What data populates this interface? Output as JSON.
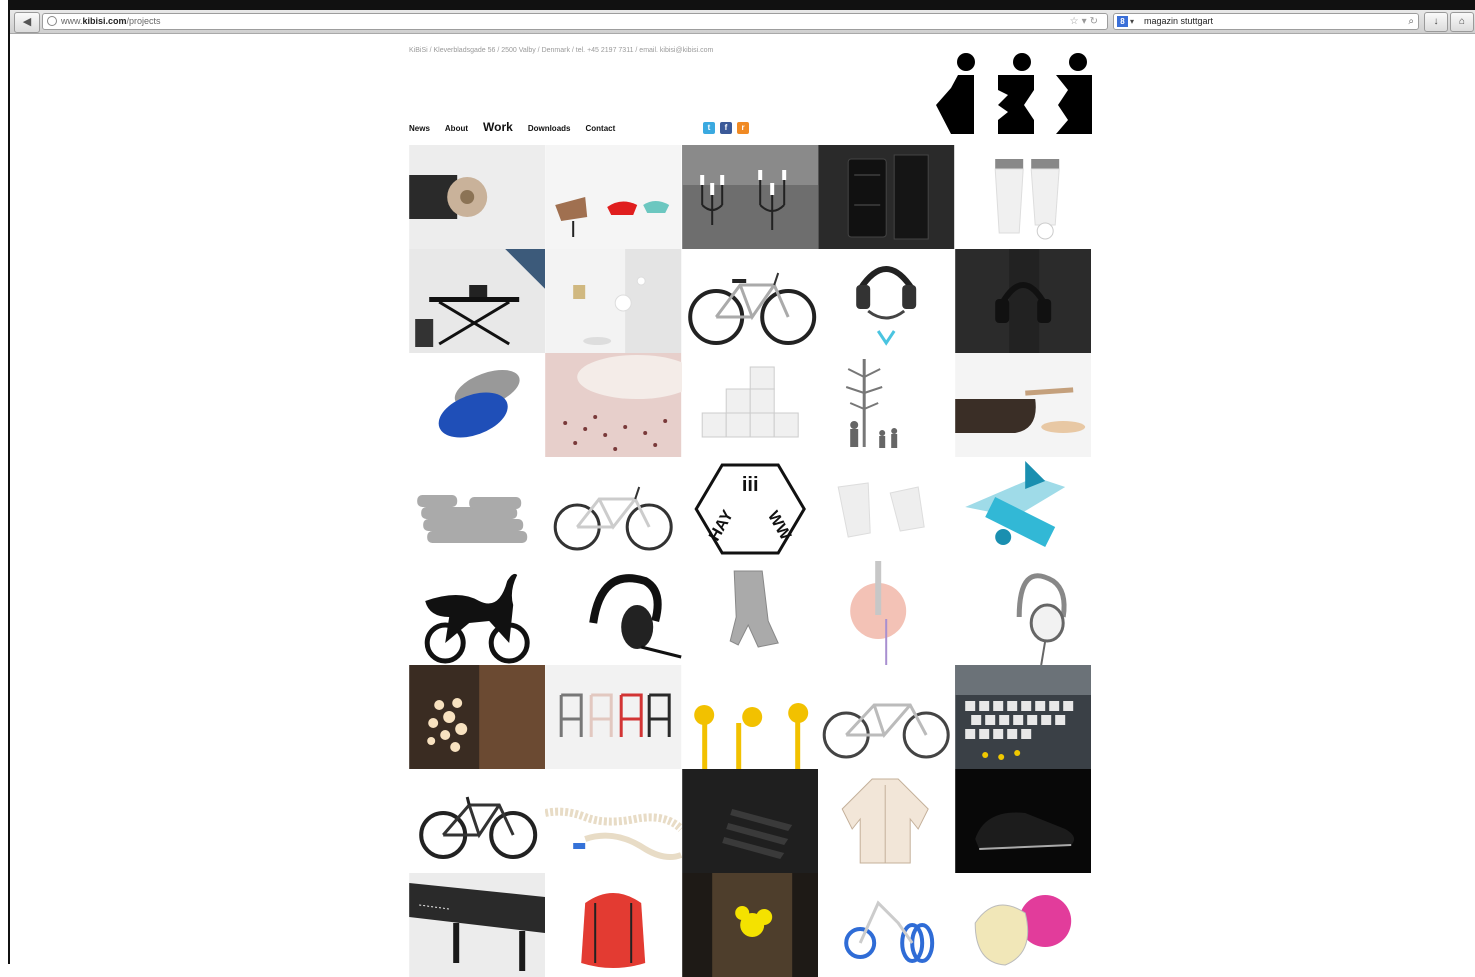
{
  "browser": {
    "url_prefix": "www.",
    "url_domain": "kibisi.com",
    "url_path": "/projects",
    "search_engine_glyph": "8",
    "search_query": "magazin stuttgart",
    "back_icon": "back-arrow-icon",
    "bookmark_icon": "star-icon",
    "reload_icon": "reload-icon",
    "download_icon": "download-icon",
    "home_icon": "home-icon"
  },
  "site": {
    "address_line": "KiBiSi / Kleverbladsgade 56 / 2500 Valby / Denmark / tel. +45 2197 7311 / email. kibisi@kibisi.com",
    "nav": [
      "News",
      "About",
      "Work",
      "Downloads",
      "Contact"
    ],
    "active_nav": "Work",
    "social": [
      {
        "name": "twitter-icon",
        "glyph": "t",
        "color": "#3aa9e0"
      },
      {
        "name": "facebook-icon",
        "glyph": "f",
        "color": "#3b5998"
      },
      {
        "name": "rss-icon",
        "glyph": "r",
        "color": "#f08a24"
      }
    ],
    "hay_www_badge": {
      "top": "iii",
      "left": "HAY",
      "right": "WW"
    }
  },
  "projects": [
    {
      "name": "wooden-fan-lamp"
    },
    {
      "name": "lounge-chairs"
    },
    {
      "name": "candle-holders"
    },
    {
      "name": "dark-electronics"
    },
    {
      "name": "white-salt-pepper"
    },
    {
      "name": "work-desk"
    },
    {
      "name": "white-interior"
    },
    {
      "name": "bicycle-grey"
    },
    {
      "name": "headphones-stand"
    },
    {
      "name": "dark-headphones"
    },
    {
      "name": "blue-grey-pouf"
    },
    {
      "name": "pink-dots-surface"
    },
    {
      "name": "shelf-system"
    },
    {
      "name": "tree-hanger"
    },
    {
      "name": "pan-and-spoon"
    },
    {
      "name": "sandbag-sofa"
    },
    {
      "name": "white-bicycle"
    },
    {
      "name": "hay-www-badge"
    },
    {
      "name": "white-chairs"
    },
    {
      "name": "blue-plane-toy"
    },
    {
      "name": "puma-bike-logo"
    },
    {
      "name": "black-headphones"
    },
    {
      "name": "metal-chair"
    },
    {
      "name": "pink-disc"
    },
    {
      "name": "white-headphones"
    },
    {
      "name": "bubble-chandelier"
    },
    {
      "name": "colored-chairs"
    },
    {
      "name": "yellow-earphones"
    },
    {
      "name": "white-city-bike"
    },
    {
      "name": "modular-wall-event"
    },
    {
      "name": "black-bicycle"
    },
    {
      "name": "coiled-cable"
    },
    {
      "name": "black-hooks"
    },
    {
      "name": "rain-jacket"
    },
    {
      "name": "black-sneaker"
    },
    {
      "name": "black-table"
    },
    {
      "name": "red-bag"
    },
    {
      "name": "yellow-stairwell"
    },
    {
      "name": "blue-balance-bike"
    },
    {
      "name": "pink-sphere-lamp"
    }
  ]
}
